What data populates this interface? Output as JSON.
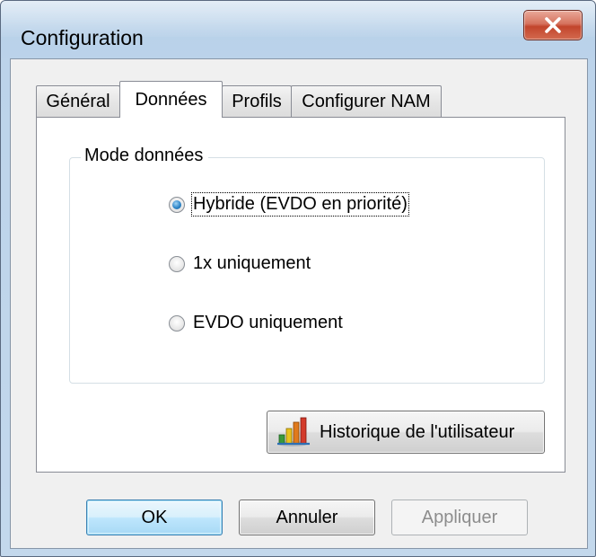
{
  "window": {
    "title": "Configuration",
    "close_label": "X"
  },
  "tabs": [
    {
      "label": "Général",
      "active": false
    },
    {
      "label": "Données",
      "active": true
    },
    {
      "label": "Profils",
      "active": false
    },
    {
      "label": "Configurer NAM",
      "active": false
    }
  ],
  "data_mode": {
    "legend": "Mode données",
    "options": [
      {
        "label": "Hybride (EVDO en priorité)",
        "selected": true
      },
      {
        "label": "1x uniquement",
        "selected": false
      },
      {
        "label": "EVDO uniquement",
        "selected": false
      }
    ]
  },
  "history_button": {
    "label": "Historique de l'utilisateur",
    "icon": "bar-chart-icon"
  },
  "footer": {
    "ok_label": "OK",
    "cancel_label": "Annuler",
    "apply_label": "Appliquer",
    "apply_enabled": false
  },
  "colors": {
    "close_button": "#c2452c",
    "ok_button_border": "#3c7fb1",
    "radio_selected": "#2f86c8"
  }
}
